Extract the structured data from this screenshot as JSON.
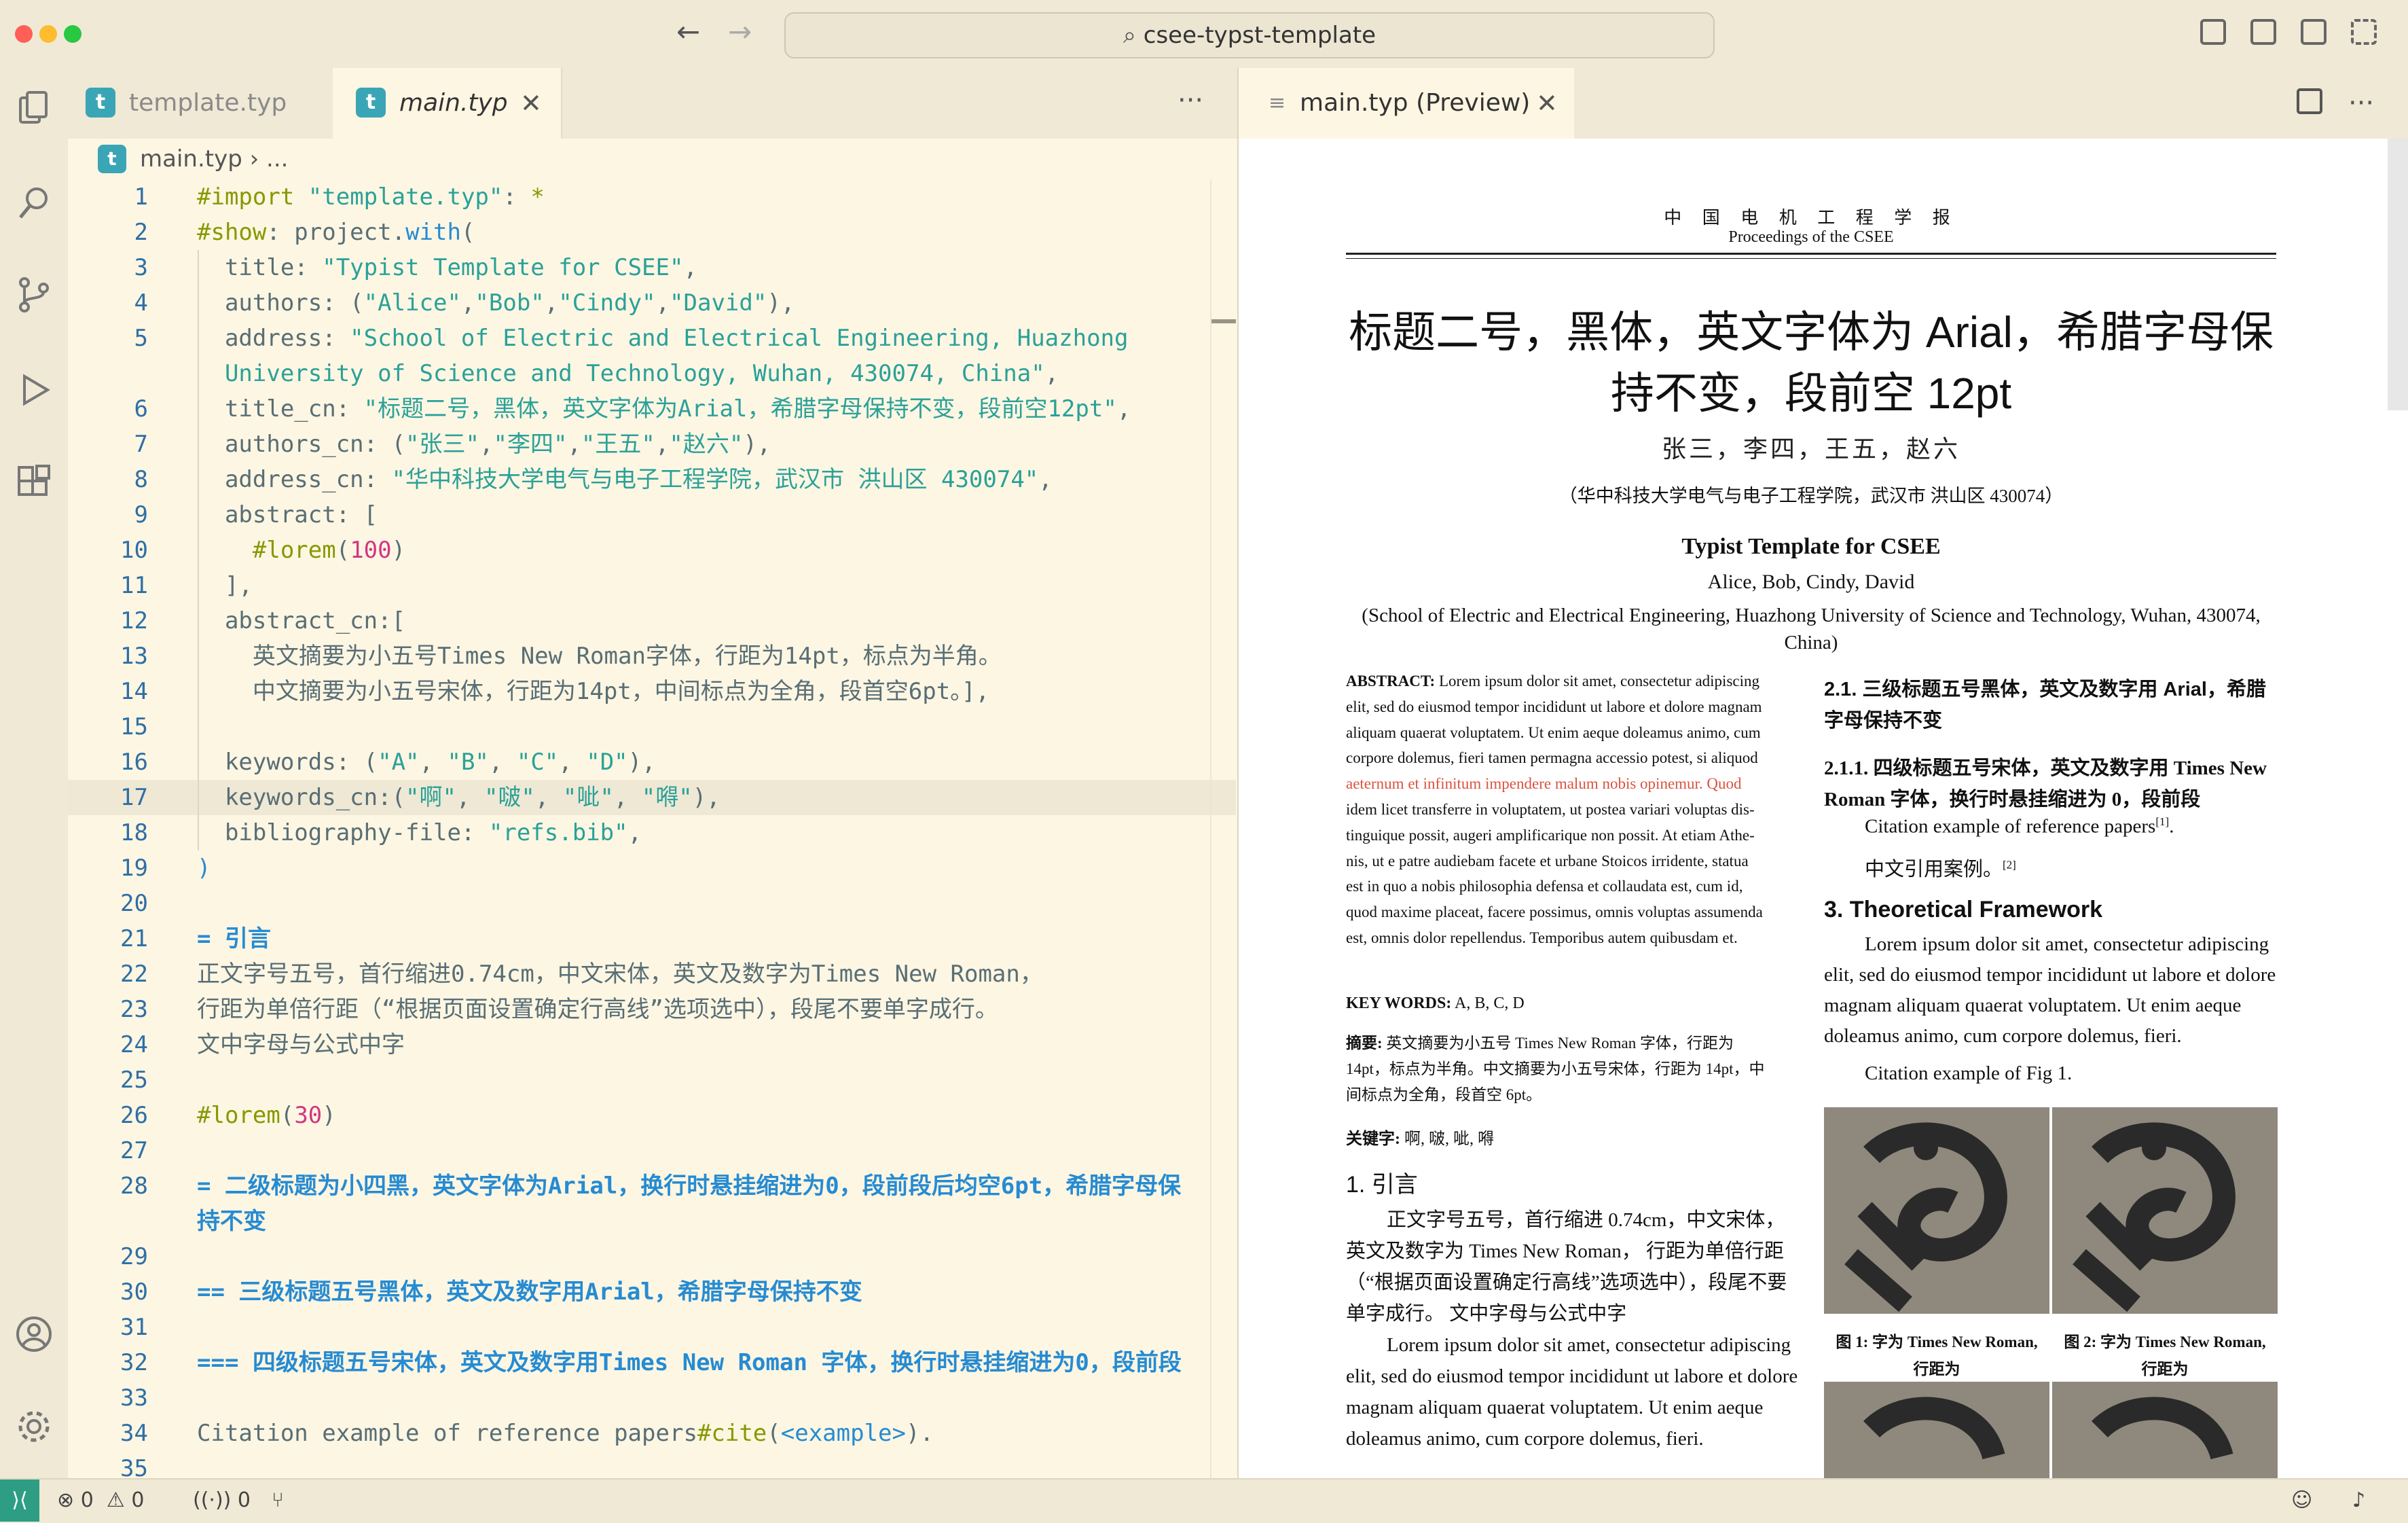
{
  "window": {
    "address_bar": "csee-typst-template",
    "traffic_light_colors": {
      "close": "#ff5f57",
      "minimize": "#febc2e",
      "zoom": "#28c840"
    }
  },
  "editor": {
    "tabs": [
      {
        "label": "template.typ",
        "active": false
      },
      {
        "label": "main.typ",
        "active": true
      }
    ],
    "breadcrumb": {
      "file": "main.typ",
      "rest": "..."
    },
    "current_line": 17,
    "lines": [
      {
        "n": "1",
        "html": "<span class='kw'>#import</span> <span class='st'>\"template.typ\"</span>: <span class='kw'>*</span>"
      },
      {
        "n": "2",
        "html": "<span class='kw'>#show</span>: project.<span class='fn'>with</span>("
      },
      {
        "n": "3",
        "html": "  title: <span class='st'>\"Typist Template for CSEE\"</span>,"
      },
      {
        "n": "4",
        "html": "  authors: (<span class='st'>\"Alice\"</span>,<span class='st'>\"Bob\"</span>,<span class='st'>\"Cindy\"</span>,<span class='st'>\"David\"</span>),"
      },
      {
        "n": "5",
        "html": "  address: <span class='st'>\"School of Electric and Electrical Engineering, Huazhong</span>"
      },
      {
        "n": "",
        "html": "  <span class='st'>University of Science and Technology, Wuhan, 430074, China\"</span>,"
      },
      {
        "n": "6",
        "html": "  title_cn: <span class='st'>\"标题二号，黑体，英文字体为Arial，希腊字母保持不变，段前空12pt\"</span>,"
      },
      {
        "n": "7",
        "html": "  authors_cn: (<span class='st'>\"张三\"</span>,<span class='st'>\"李四\"</span>,<span class='st'>\"王五\"</span>,<span class='st'>\"赵六\"</span>),"
      },
      {
        "n": "8",
        "html": "  address_cn: <span class='st'>\"华中科技大学电气与电子工程学院，武汉市 洪山区 430074\"</span>,"
      },
      {
        "n": "9",
        "html": "  abstract: ["
      },
      {
        "n": "10",
        "html": "    <span class='kw'>#lorem</span>(<span class='num'>100</span>)"
      },
      {
        "n": "11",
        "html": "  ],"
      },
      {
        "n": "12",
        "html": "  abstract_cn:["
      },
      {
        "n": "13",
        "html": "    英文摘要为小五号Times New Roman字体，行距为14pt，标点为半角。"
      },
      {
        "n": "14",
        "html": "    中文摘要为小五号宋体，行距为14pt，中间标点为全角，段首空6pt。],"
      },
      {
        "n": "15",
        "html": ""
      },
      {
        "n": "16",
        "html": "  keywords: (<span class='st'>\"A\"</span>, <span class='st'>\"B\"</span>, <span class='st'>\"C\"</span>, <span class='st'>\"D\"</span>),"
      },
      {
        "n": "17",
        "html": "  keywords_cn:(<span class='st'>\"啊\"</span>, <span class='st'>\"啵\"</span>, <span class='st'>\"呲\"</span>, <span class='st'>\"嘚\"</span>),"
      },
      {
        "n": "18",
        "html": "  bibliography-file: <span class='st'>\"refs.bib\"</span>,"
      },
      {
        "n": "19",
        "html": "<span class='fn'>)</span>"
      },
      {
        "n": "20",
        "html": ""
      },
      {
        "n": "21",
        "html": "<span class='hd'>= 引言</span>"
      },
      {
        "n": "22",
        "html": "正文字号五号，首行缩进0.74cm，中文宋体，英文及数字为Times New Roman，"
      },
      {
        "n": "23",
        "html": "行距为单倍行距（“根据页面设置确定行高线”选项选中），段尾不要单字成行。"
      },
      {
        "n": "24",
        "html": "文中字母与公式中字"
      },
      {
        "n": "25",
        "html": ""
      },
      {
        "n": "26",
        "html": "<span class='kw'>#lorem</span>(<span class='num'>30</span>)"
      },
      {
        "n": "27",
        "html": ""
      },
      {
        "n": "28",
        "html": "<span class='hd'>= 二级标题为小四黑，英文字体为Arial，换行时悬挂缩进为0，段前段后均空6pt，希腊字母保</span>"
      },
      {
        "n": "",
        "html": "<span class='hd'>持不变</span>"
      },
      {
        "n": "29",
        "html": ""
      },
      {
        "n": "30",
        "html": "<span class='hd'>== 三级标题五号黑体，英文及数字用Arial，希腊字母保持不变</span>"
      },
      {
        "n": "31",
        "html": ""
      },
      {
        "n": "32",
        "html": "<span class='hd'>=== 四级标题五号宋体，英文及数字用Times New Roman 字体，换行时悬挂缩进为0，段前段</span>"
      },
      {
        "n": "33",
        "html": ""
      },
      {
        "n": "34",
        "html": "Citation example of reference papers<span class='kw'>#cite</span>(<span class='fn'>&lt;example&gt;</span>)."
      },
      {
        "n": "35",
        "html": ""
      }
    ]
  },
  "preview": {
    "tab_label": "main.typ (Preview)",
    "journal_cn": "中 国 电 机 工 程 学 报",
    "journal_en": "Proceedings of the CSEE",
    "title_cn_line1": "标题二号，黑体，英文字体为 Arial，希腊字母保",
    "title_cn_line2": "持不变，段前空 12pt",
    "authors_cn": "张三，李四，王五，赵六",
    "address_cn": "（华中科技大学电气与电子工程学院，武汉市 洪山区 430074）",
    "title_en": "Typist Template for CSEE",
    "authors_en": "Alice, Bob, Cindy, David",
    "address_en_line1": "(School of Electric and Electrical Engineering, Huazhong University of Science and Technology, Wuhan, 430074,",
    "address_en_line2": "China)",
    "abstract_label": "ABSTRACT:",
    "abstract_lines": [
      " Lorem ipsum dolor sit amet, consectetur adipiscing",
      "elit, sed do eiusmod tempor incididunt ut labore et dolore magnam",
      "aliquam quaerat voluptatem. Ut enim aeque doleamus animo, cum",
      "corpore dolemus, fieri tamen permagna accessio potest, si aliquod",
      "aeternum et infinitum impendere malum nobis opinemur. Quod",
      "idem licet transferre in voluptatem, ut postea variari voluptas dis-",
      "tinguique possit, augeri amplificarique non possit. At etiam Athe-",
      "nis, ut e patre audiebam facete et urbane Stoicos irridente, statua",
      "est in quo a nobis philosophia defensa et collaudata est, cum id,",
      "quod maxime placeat, facere possimus, omnis voluptas assumenda",
      "est, omnis dolor repellendus. Temporibus autem quibusdam et."
    ],
    "keywords_label": "KEY WORDS:",
    "keywords_value": " A, B, C, D",
    "abstract_cn_label": "摘要:",
    "abstract_cn_lines": [
      " 英文摘要为小五号 Times New Roman 字体，行距为",
      "14pt，标点为半角。中文摘要为小五号宋体，行距为 14pt，中",
      "间标点为全角，段首空 6pt。"
    ],
    "keywords_cn_label": "关键字:",
    "keywords_cn_value": " 啊, 啵, 呲, 嘚",
    "sec1_heading": "1. 引言",
    "sec1_lines": [
      "正文字号五号，首行缩进 0.74cm，中文宋体，",
      "英文及数字为 Times New Roman， 行距为单倍行距",
      "（“根据页面设置确定行高线”选项选中），段尾不要",
      "单字成行。 文中字母与公式中字"
    ],
    "lorem_lines": [
      "Lorem ipsum dolor sit amet, consectetur adipiscing",
      "elit, sed do eiusmod tempor incididunt ut labore et dolore",
      "magnam aliquam quaerat voluptatem. Ut enim aeque",
      "doleamus animo, cum corpore dolemus, fieri."
    ],
    "sec21_heading_line1": "2.1. 三级标题五号黑体，英文及数字用 Arial，希腊",
    "sec21_heading_line2": "字母保持不变",
    "sec211_heading_line1": "2.1.1. 四级标题五号宋体，英文及数字用 Times New",
    "sec211_heading_line2": "Roman 字体，换行时悬挂缩进为 0，段前段",
    "citation_paper": "Citation example of reference papers",
    "citation_paper_ref": "[1]",
    "citation_cn": "中文引用案例。",
    "citation_cn_ref": "[2]",
    "sec3_heading": "3. Theoretical Framework",
    "sec3_lines": [
      "Lorem ipsum dolor sit amet, consectetur adipiscing",
      "elit, sed do eiusmod tempor incididunt ut labore et dolore",
      "magnam aliquam quaerat voluptatem. Ut enim aeque",
      "doleamus animo, cum corpore dolemus, fieri."
    ],
    "fig_citation": "Citation example of Fig 1.",
    "fig1_caption_line1": "图 1: 字为 Times New Roman,",
    "fig1_caption_line2": "行距为",
    "fig2_caption_line1": "图 2: 字为 Times New Roman,",
    "fig2_caption_line2": "行距为"
  },
  "status_bar": {
    "errors": "0",
    "warnings": "0",
    "ports": "0"
  }
}
